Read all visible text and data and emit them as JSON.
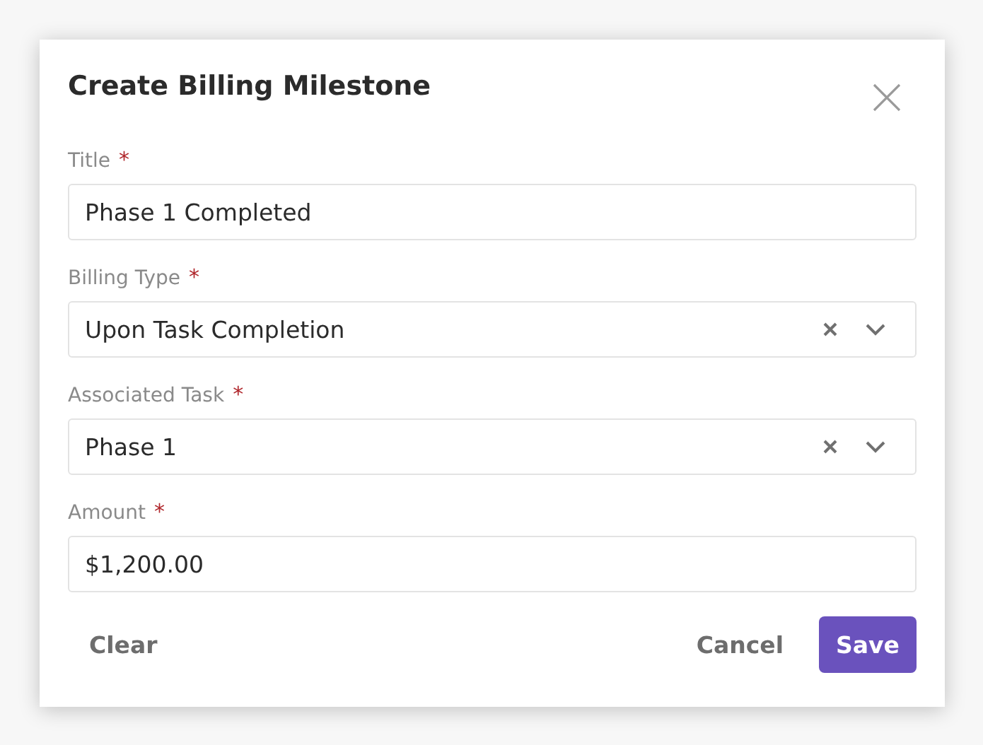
{
  "dialog": {
    "title": "Create Billing Milestone"
  },
  "fields": [
    {
      "label": "Title",
      "required_mark": "*",
      "kind": "text",
      "value": "Phase 1 Completed"
    },
    {
      "label": "Billing Type",
      "required_mark": "*",
      "kind": "select",
      "value": "Upon Task Completion"
    },
    {
      "label": "Associated Task",
      "required_mark": "*",
      "kind": "select",
      "value": "Phase 1"
    },
    {
      "label": "Amount",
      "required_mark": "*",
      "kind": "text",
      "value": "$1,200.00"
    }
  ],
  "footer": {
    "clear": "Clear",
    "cancel": "Cancel",
    "save": "Save"
  }
}
